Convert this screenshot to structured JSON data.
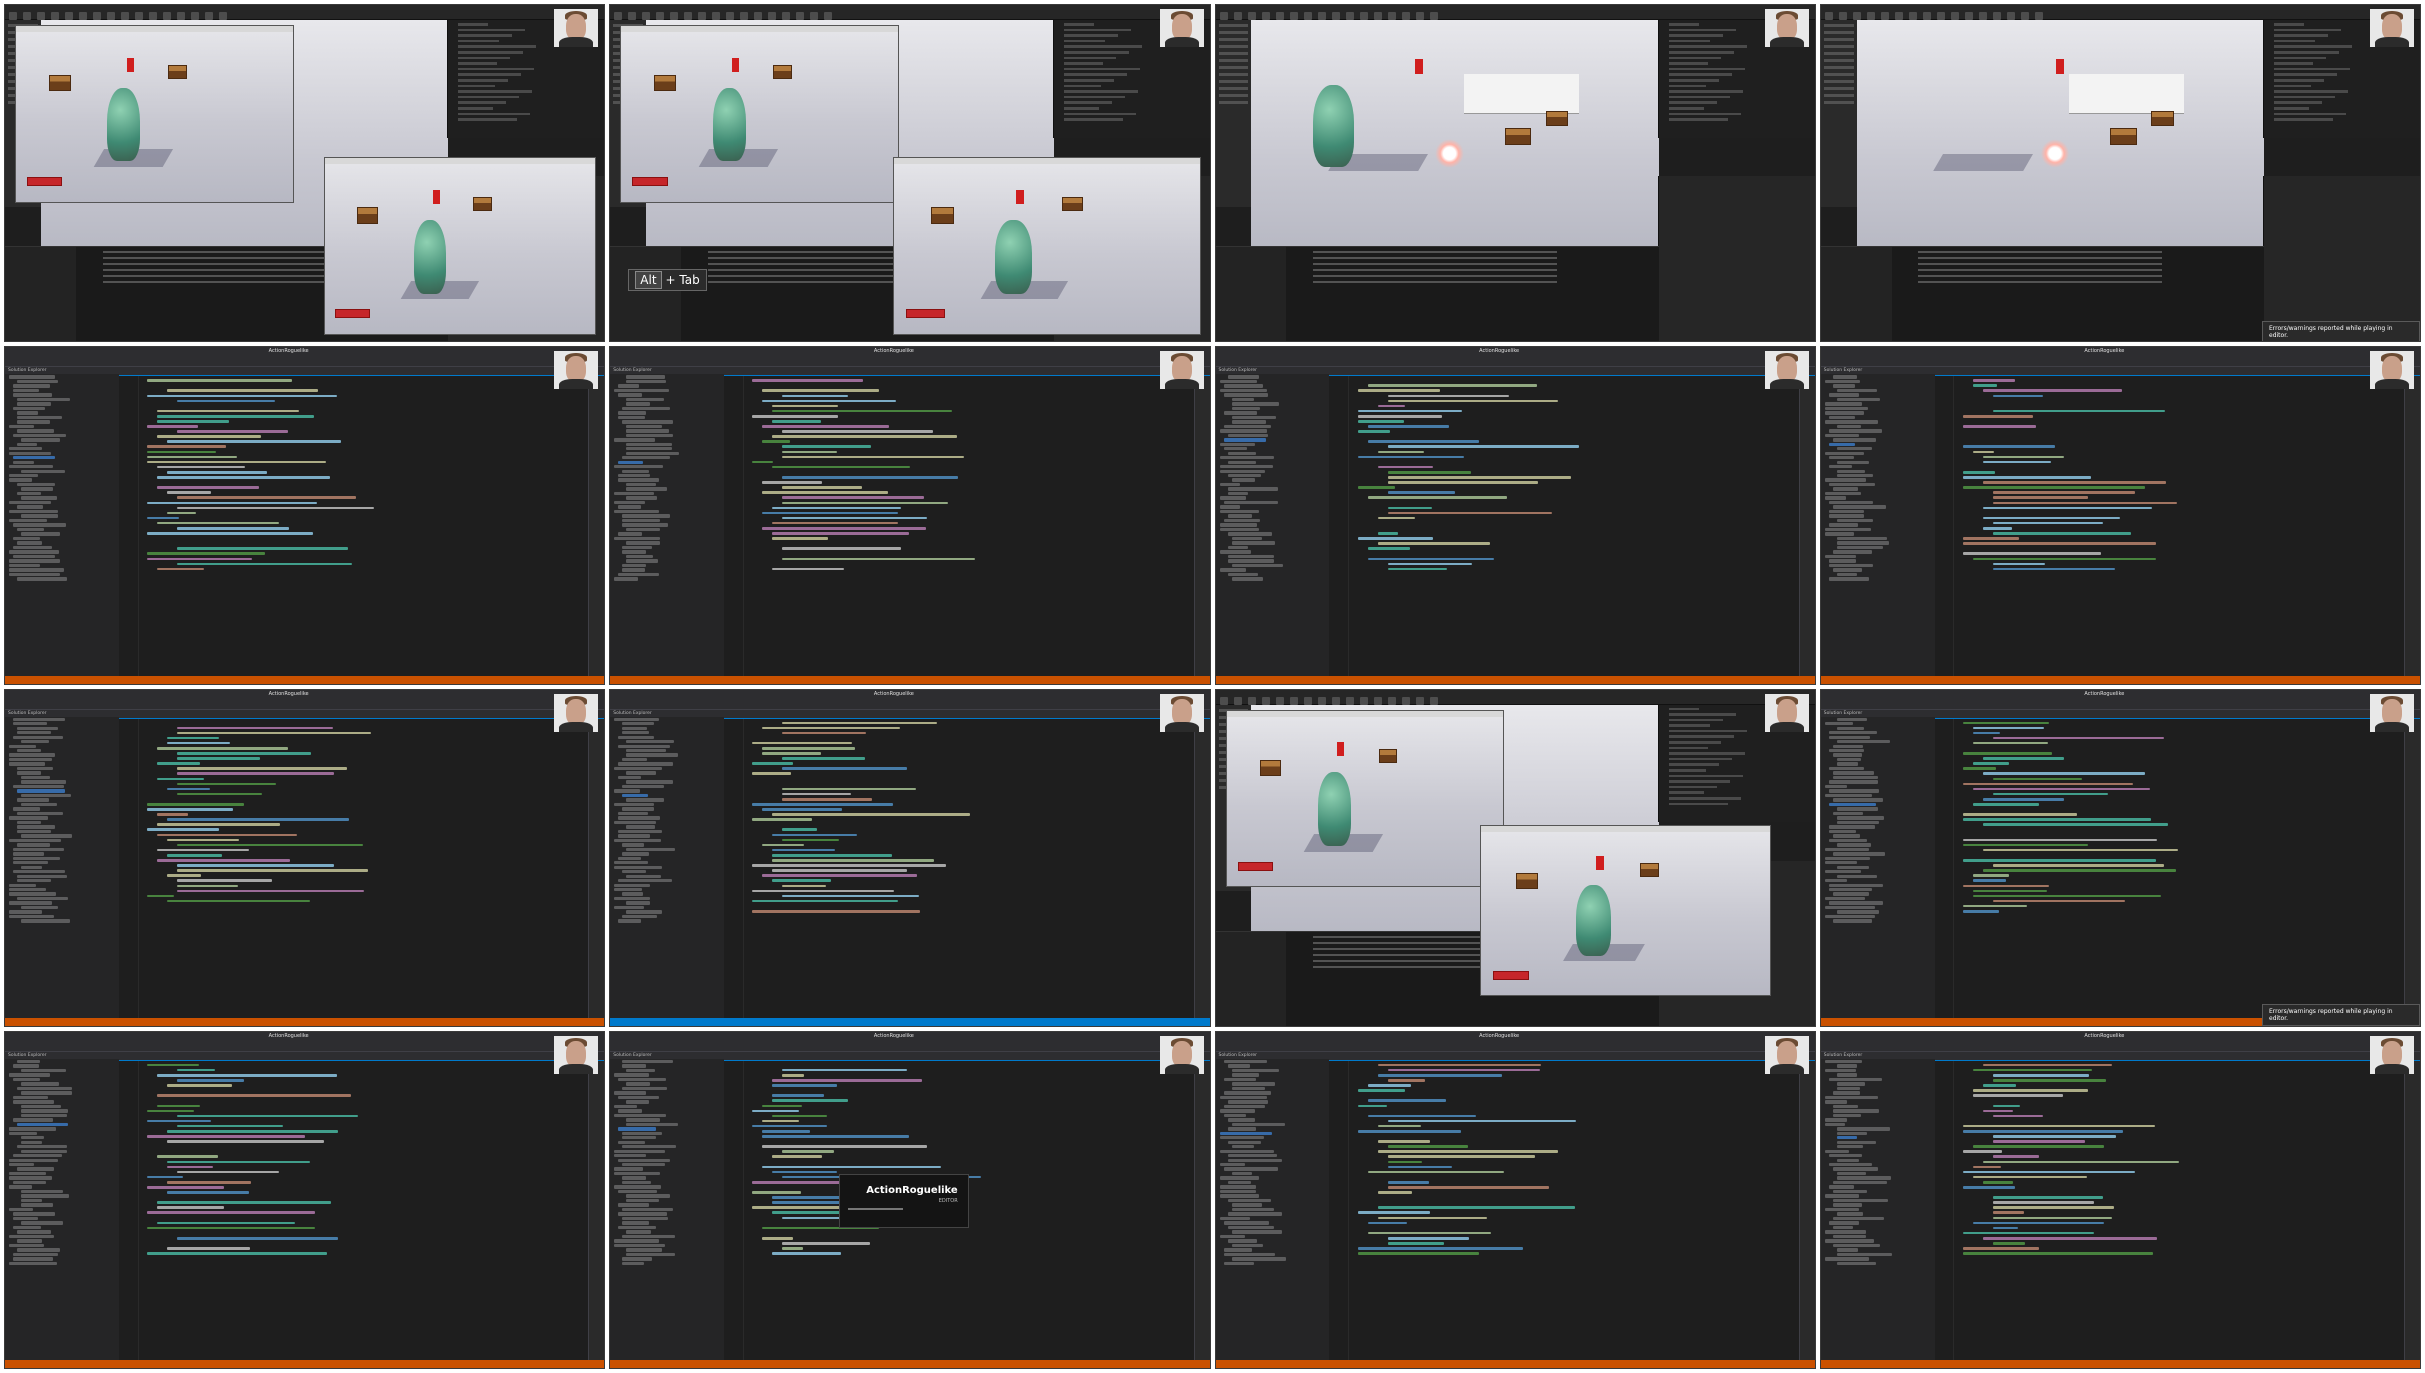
{
  "sheet": {
    "columns": 4,
    "rows": 4
  },
  "vs": {
    "window_title": "ActionRoguelike",
    "menu": [
      "File",
      "Edit",
      "View",
      "Git",
      "Project",
      "Build",
      "Debug",
      "Test",
      "Analyze",
      "Tools",
      "Extensions",
      "Window",
      "Help"
    ],
    "solution_header": "Solution Explorer",
    "status_ready": "Ready"
  },
  "ue": {
    "alt_tab_key": "Alt",
    "alt_tab_label": "+ Tab",
    "error_toast": "Errors/warnings reported while playing in editor.",
    "error_toast_small": "Errors/warnings reported while playing in editor."
  },
  "splash": {
    "title": "ActionRoguelike",
    "subtitle": "EDITOR"
  },
  "colors": {
    "vs_status_orange": "#ca5100",
    "vs_status_blue": "#007acc",
    "vs_bg": "#1e1e1e"
  }
}
